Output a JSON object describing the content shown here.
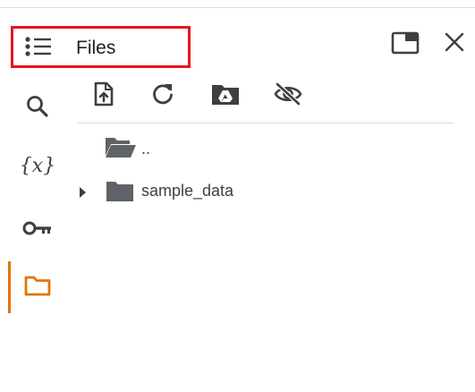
{
  "header": {
    "title": "Files"
  },
  "sidebar": {
    "items": [
      {
        "name": "search",
        "icon": "search-icon"
      },
      {
        "name": "variables",
        "icon": "variables-icon",
        "glyph": "{x}"
      },
      {
        "name": "secrets",
        "icon": "key-icon"
      },
      {
        "name": "files",
        "icon": "folder-icon",
        "active": true
      }
    ]
  },
  "toolbar": {
    "items": [
      {
        "name": "upload",
        "icon": "upload-file-icon"
      },
      {
        "name": "refresh",
        "icon": "refresh-icon"
      },
      {
        "name": "mount-drive",
        "icon": "drive-folder-icon"
      },
      {
        "name": "hide-files",
        "icon": "eye-off-icon"
      }
    ]
  },
  "tree": {
    "parent_label": "..",
    "items": [
      {
        "label": "sample_data",
        "type": "folder",
        "expanded": false
      }
    ]
  },
  "colors": {
    "highlight": "#e8141b",
    "active_accent": "#e37400",
    "icon": "#3c4043",
    "folder": "#5f6368"
  }
}
